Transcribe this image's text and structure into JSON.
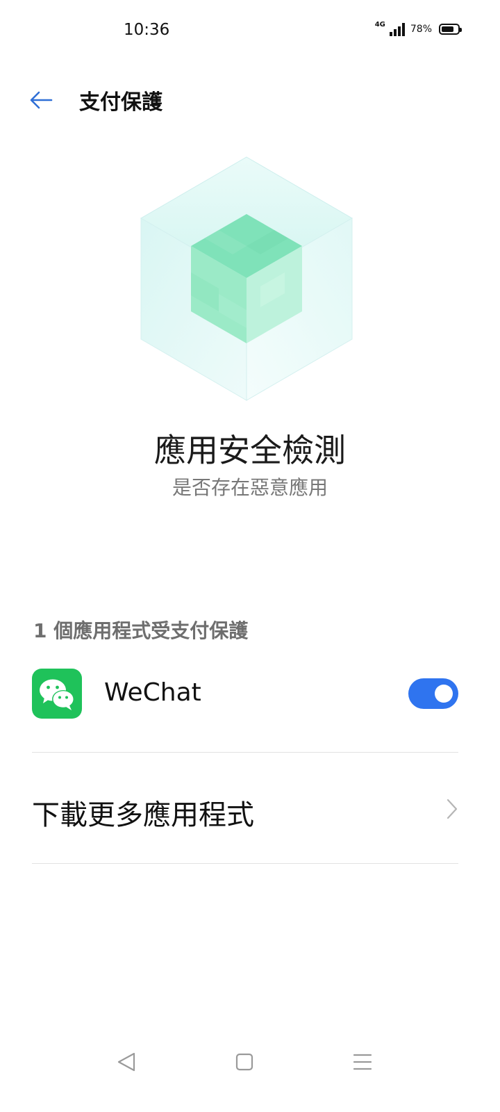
{
  "status_bar": {
    "time": "10:36",
    "network": "4G",
    "battery_percent": "78%",
    "battery_level": 0.78,
    "icons": [
      "signal-icon",
      "battery-icon"
    ]
  },
  "header": {
    "title": "支付保護",
    "back_icon": "arrow-left-icon"
  },
  "hero": {
    "title": "應用安全檢測",
    "subtitle": "是否存在惡意應用"
  },
  "section": {
    "label": "1 個應用程式受支付保護"
  },
  "apps": [
    {
      "name": "WeChat",
      "icon": "wechat-icon",
      "enabled": true
    }
  ],
  "more": {
    "label": "下載更多應用程式",
    "icon": "chevron-right-icon"
  },
  "colors": {
    "accent": "#2f74ef",
    "wechat": "#1fc25a",
    "cube": "#7ee3b8"
  },
  "navbar": {
    "icons": [
      "nav-back-icon",
      "nav-home-icon",
      "nav-menu-icon"
    ]
  }
}
